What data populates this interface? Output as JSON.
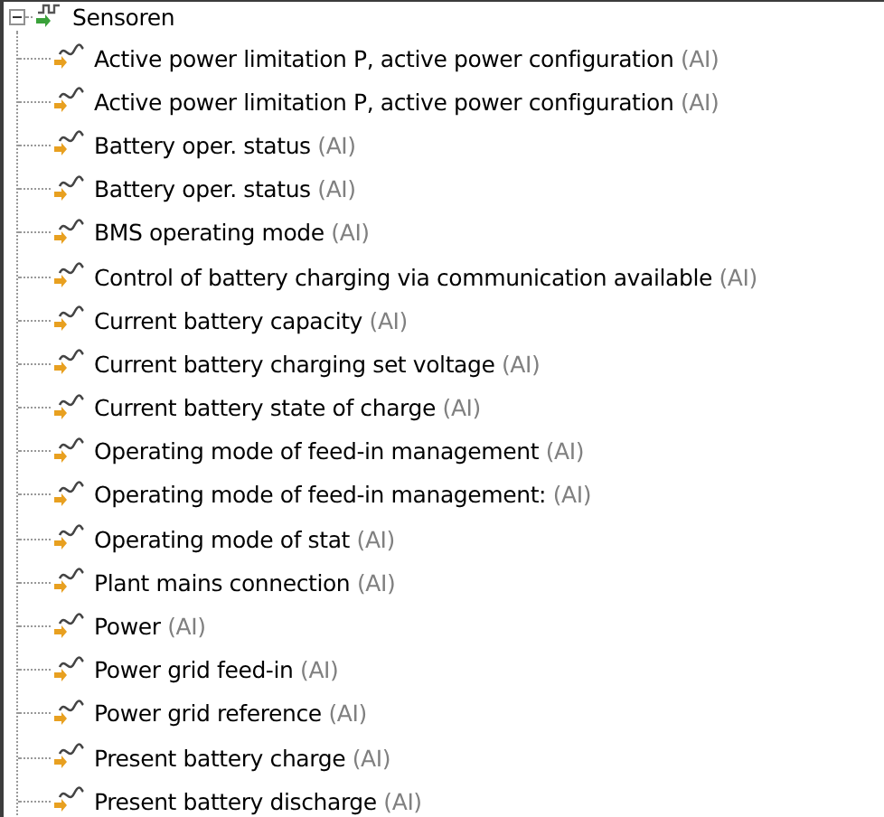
{
  "tree": {
    "label": "Sensoren",
    "expanded": true,
    "children": [
      {
        "label": "Active power limitation P, active power configuration",
        "suffix": "(AI)"
      },
      {
        "label": "Active power limitation P, active power configuration",
        "suffix": "(AI)"
      },
      {
        "label": "Battery oper. status",
        "suffix": "(AI)"
      },
      {
        "label": "Battery oper. status",
        "suffix": "(AI)"
      },
      {
        "label": "BMS operating mode",
        "suffix": "(AI)"
      },
      {
        "label": "Control of battery charging via communication available",
        "suffix": "(AI)"
      },
      {
        "label": "Current battery capacity",
        "suffix": "(AI)"
      },
      {
        "label": "Current battery charging set voltage",
        "suffix": "(AI)"
      },
      {
        "label": "Current battery state of charge",
        "suffix": "(AI)"
      },
      {
        "label": "Operating mode of feed-in management",
        "suffix": "(AI)"
      },
      {
        "label": "Operating mode of feed-in management:",
        "suffix": "(AI)"
      },
      {
        "label": "Operating mode of stat",
        "suffix": "(AI)"
      },
      {
        "label": "Plant mains connection",
        "suffix": "(AI)"
      },
      {
        "label": "Power",
        "suffix": "(AI)"
      },
      {
        "label": "Power grid feed-in",
        "suffix": "(AI)"
      },
      {
        "label": "Power grid reference",
        "suffix": "(AI)"
      },
      {
        "label": "Present battery charge",
        "suffix": "(AI)"
      },
      {
        "label": "Present battery discharge",
        "suffix": "(AI)"
      }
    ]
  }
}
